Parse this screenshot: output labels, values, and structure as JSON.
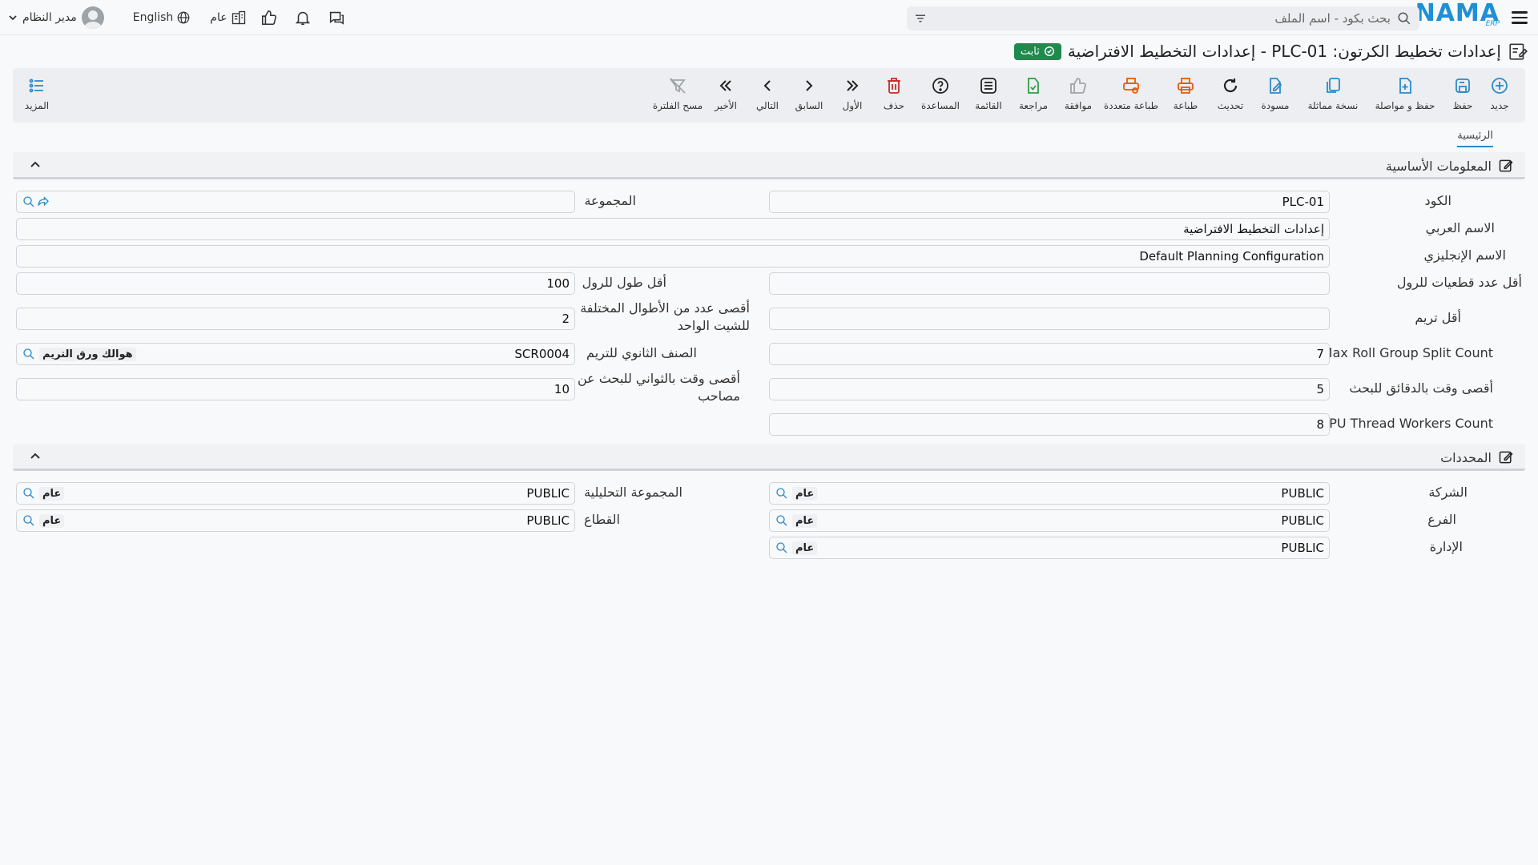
{
  "header": {
    "logo_text": "NAMA",
    "logo_sub": "ERP",
    "search_placeholder": "بحث بكود - اسم الملف",
    "user_name": "مدير النظام",
    "language": "English",
    "scope": "عام"
  },
  "page": {
    "title": "إعدادات تخطيط الكرتون: PLC-01 - إعدادات التخطيط الافتراضية",
    "status": "ثابت"
  },
  "toolbar": {
    "new": "جديد",
    "save": "حفظ",
    "save_continue": "حفظ و مواصلة",
    "duplicate": "نسخة مماثلة",
    "draft": "مسودة",
    "refresh": "تحديث",
    "print": "طباعة",
    "multi_print": "طباعة متعددة",
    "approve": "موافقة",
    "review": "مراجعة",
    "list": "القائمة",
    "help": "المساعدة",
    "delete": "حذف",
    "first": "الأول",
    "previous": "السابق",
    "next": "التالي",
    "last": "الأخير",
    "clear_filter": "مسح الفلترة",
    "more": "المزيد"
  },
  "tabs": {
    "main": "الرئيسية"
  },
  "sections": {
    "basic_info": "المعلومات الأساسية",
    "determinants": "المحددات"
  },
  "fields": {
    "code": {
      "label": "الكود",
      "value": "PLC-01"
    },
    "group": {
      "label": "المجموعة",
      "value": ""
    },
    "arabic_name": {
      "label": "الاسم العربي",
      "value": "إعدادات التخطيط الافتراضية"
    },
    "english_name": {
      "label": "الاسم الإنجليزي",
      "value": "Default Planning Configuration"
    },
    "min_roll_cuts": {
      "label": "أقل عدد قطعيات للرول",
      "value": ""
    },
    "min_roll_length": {
      "label": "أقل طول للرول",
      "value": "100"
    },
    "min_trim": {
      "label": "أقل تريم",
      "value": ""
    },
    "max_lengths_per_sheet": {
      "label": "أقصى عدد من الأطوال المختلفة للشيت الواحد",
      "value": "2"
    },
    "max_roll_group_split": {
      "label": "Max Roll Group Split Count",
      "value": "7"
    },
    "trim_secondary_item": {
      "label": "الصنف الثانوي للتريم",
      "value": "SCR0004",
      "tag": "هوالك ورق التريم"
    },
    "max_search_minutes": {
      "label": "أقصى وقت بالدقائق للبحث",
      "value": "5"
    },
    "max_search_seconds": {
      "label": "أقصى وقت بالثواني للبحث عن مصاحب",
      "value": "10"
    },
    "cpu_threads": {
      "label": "CPU Thread Workers Count",
      "value": "8"
    }
  },
  "determinants": {
    "company": {
      "label": "الشركة",
      "value": "PUBLIC",
      "tag": "عام"
    },
    "analytic_group": {
      "label": "المجموعة التحليلية",
      "value": "PUBLIC",
      "tag": "عام"
    },
    "branch": {
      "label": "الفرع",
      "value": "PUBLIC",
      "tag": "عام"
    },
    "sector": {
      "label": "القطاع",
      "value": "PUBLIC",
      "tag": "عام"
    },
    "department": {
      "label": "الإدارة",
      "value": "PUBLIC",
      "tag": "عام"
    }
  },
  "colors": {
    "brand": "#1f8fd6",
    "status_badge": "#1e8a4c",
    "toolbar_blue": "#2b8ac9",
    "toolbar_orange": "#e8590c",
    "toolbar_green": "#2f9e44",
    "toolbar_red": "#c92a2a"
  }
}
